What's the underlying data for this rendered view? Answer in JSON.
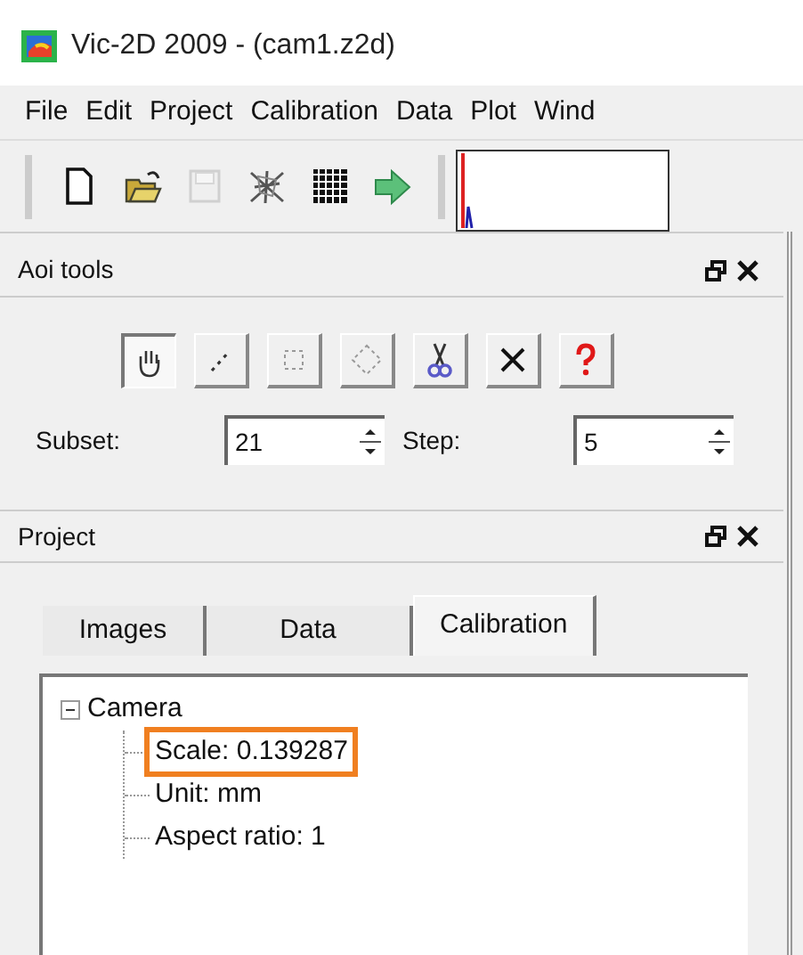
{
  "window": {
    "title": "Vic-2D 2009 - (cam1.z2d)"
  },
  "menu": [
    "File",
    "Edit",
    "Project",
    "Calibration",
    "Data",
    "Plot",
    "Wind"
  ],
  "toolbar": [
    {
      "kind": "new",
      "disabled": false
    },
    {
      "kind": "open",
      "disabled": false
    },
    {
      "kind": "save",
      "disabled": true
    },
    {
      "kind": "mesh",
      "disabled": false
    },
    {
      "kind": "grid",
      "disabled": false
    },
    {
      "kind": "arrow",
      "disabled": false
    }
  ],
  "aoi_tools": {
    "title": "Aoi tools",
    "tools": [
      {
        "kind": "hand",
        "selected": true
      },
      {
        "kind": "line",
        "selected": false
      },
      {
        "kind": "rect",
        "selected": false
      },
      {
        "kind": "polygon",
        "selected": false
      },
      {
        "kind": "cut",
        "selected": false
      },
      {
        "kind": "delete",
        "selected": false
      },
      {
        "kind": "help",
        "selected": false
      }
    ],
    "spinners": [
      {
        "label": "Subset:",
        "value": "21"
      },
      {
        "label": "Step:",
        "value": "5"
      }
    ]
  },
  "project": {
    "title": "Project",
    "tabs": [
      {
        "label": "Images",
        "selected": false
      },
      {
        "label": "Data",
        "selected": false
      },
      {
        "label": "Calibration",
        "selected": true
      }
    ],
    "tree": [
      {
        "label": "Camera",
        "expanded": true,
        "children": [
          {
            "label": "Scale: 0.139287",
            "highlighted": true
          },
          {
            "label": "Unit: mm",
            "highlighted": false
          },
          {
            "label": "Aspect ratio: 1",
            "highlighted": false
          }
        ]
      }
    ]
  }
}
